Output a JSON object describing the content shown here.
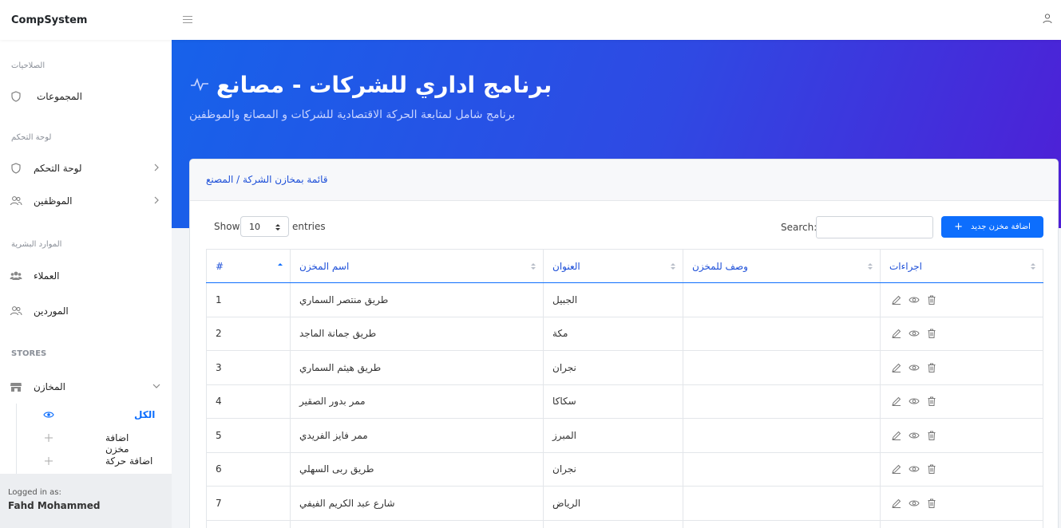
{
  "app": {
    "brand": "CompSystem"
  },
  "sidebar": {
    "sections": [
      {
        "title": "الصلاحيات"
      },
      {
        "title": "لوحة التحكم"
      },
      {
        "title": "الموارد البشرية"
      },
      {
        "title": "STORES"
      }
    ],
    "items": [
      {
        "label": "المجموعات"
      },
      {
        "label": "لوحة التحكم"
      },
      {
        "label": "الموظفين"
      },
      {
        "label": "العملاء"
      },
      {
        "label": "الموردين"
      },
      {
        "label": "المخازن"
      }
    ],
    "subitems": [
      {
        "label": "الكل"
      },
      {
        "label": "اضافة مخزن"
      },
      {
        "label": "اضافة حركة"
      }
    ],
    "logged_label": "Logged in as:",
    "user_name": "Fahd Mohammed"
  },
  "hero": {
    "title": "برنامج اداري للشركات - مصانع",
    "subtitle": "برنامج شامل لمتابعة الحركة الاقتصادية للشركات و المصانع والموظفين"
  },
  "card": {
    "title": "قائمة بمخازن الشركة / المصنع",
    "show_label": "Show",
    "page_length": "10",
    "entries_label": "entries",
    "search_label": "Search:",
    "search_value": "",
    "add_button": "اضافة مخزن جديد",
    "columns": [
      "#",
      "اسم المخزن",
      "العنوان",
      "وصف للمخزن",
      "اجراءات"
    ],
    "rows": [
      {
        "id": "1",
        "name": "طريق منتصر السماري",
        "address": "الجبيل",
        "desc": ""
      },
      {
        "id": "2",
        "name": "طريق جمانة الماجد",
        "address": "مكة",
        "desc": ""
      },
      {
        "id": "3",
        "name": "طريق هيثم السماري",
        "address": "نجران",
        "desc": ""
      },
      {
        "id": "4",
        "name": "ممر بدور الصقير",
        "address": "سكاكا",
        "desc": ""
      },
      {
        "id": "5",
        "name": "ممر فايز الفريدي",
        "address": "المبرز",
        "desc": ""
      },
      {
        "id": "6",
        "name": "طريق ربى السهلي",
        "address": "نجران",
        "desc": ""
      },
      {
        "id": "7",
        "name": "شارع عبد الكريم الفيفي",
        "address": "الرياض",
        "desc": ""
      },
      {
        "id": "",
        "name": "",
        "address": "",
        "desc": ""
      }
    ]
  },
  "colors": {
    "primary": "#0d6efd",
    "hero_start": "#1762ea",
    "hero_end": "#4e1fd6"
  }
}
